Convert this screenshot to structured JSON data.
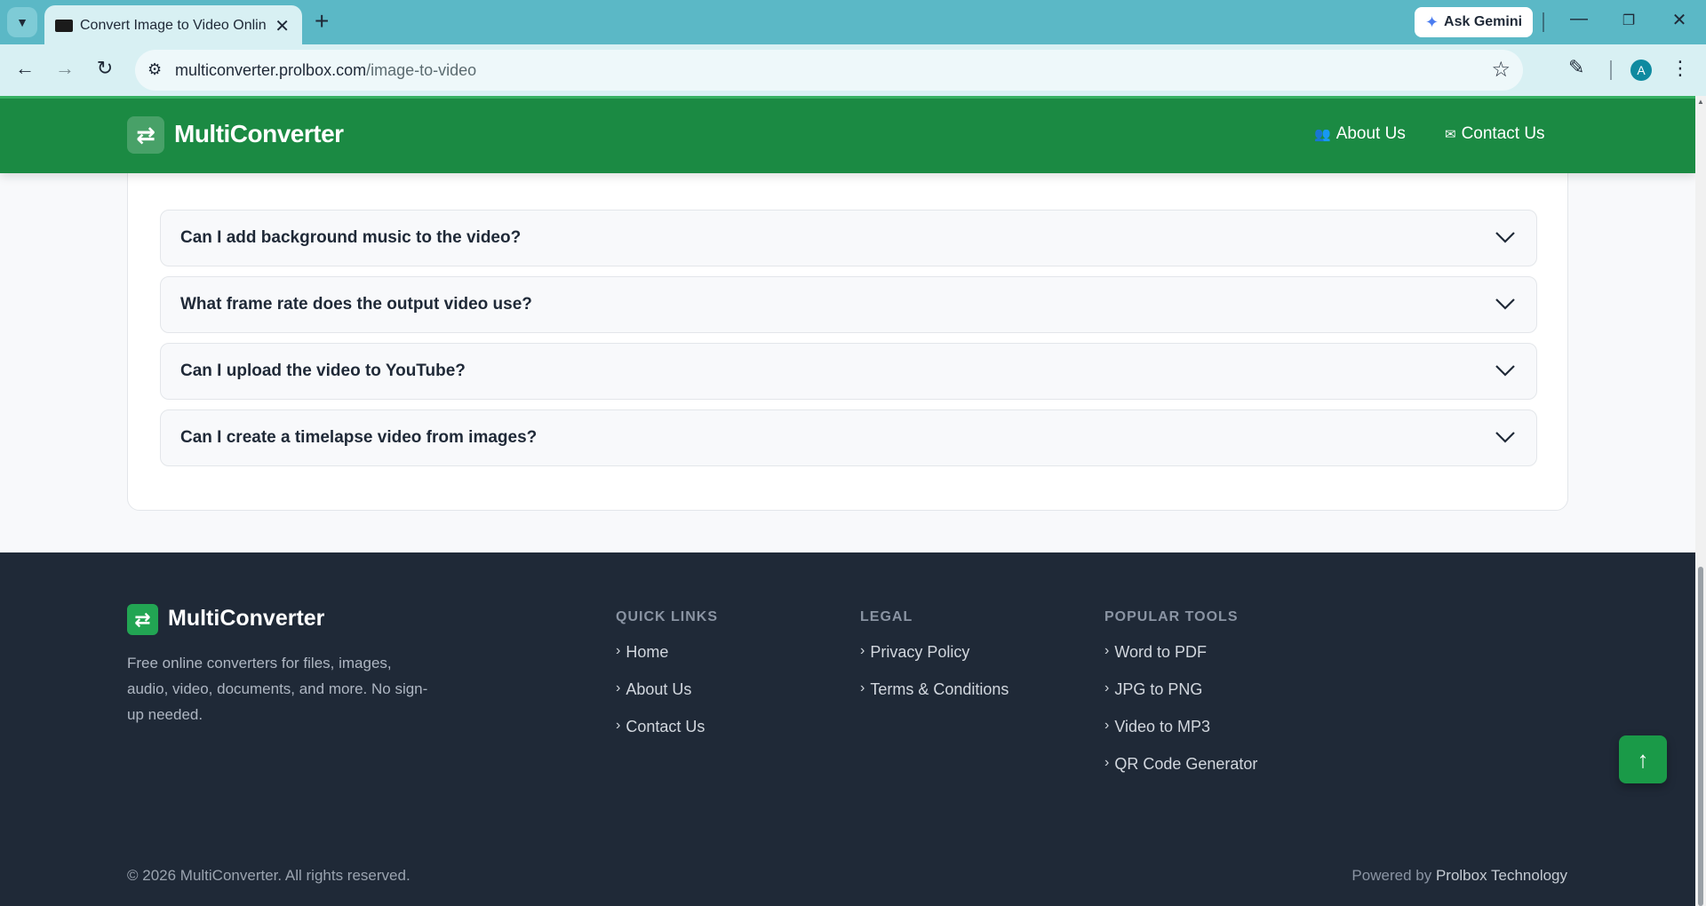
{
  "browser": {
    "tab_title": "Convert Image to Video Online",
    "url_domain": "multiconverter.prolbox.com",
    "url_path": "/image-to-video",
    "gemini_label": "Ask Gemini",
    "profile_initial": "A"
  },
  "header": {
    "logo_text": "MultiConverter",
    "nav": [
      {
        "label": "About Us",
        "icon": "users-icon"
      },
      {
        "label": "Contact Us",
        "icon": "envelope-icon"
      }
    ]
  },
  "faq": {
    "items": [
      {
        "question": "Can I add background music to the video?"
      },
      {
        "question": "What frame rate does the output video use?"
      },
      {
        "question": "Can I upload the video to YouTube?"
      },
      {
        "question": "Can I create a timelapse video from images?"
      }
    ]
  },
  "footer": {
    "logo_text": "MultiConverter",
    "description": "Free online converters for files, images, audio, video, documents, and more. No sign-up needed.",
    "columns": [
      {
        "heading": "QUICK LINKS",
        "links": [
          "Home",
          "About Us",
          "Contact Us"
        ]
      },
      {
        "heading": "LEGAL",
        "links": [
          "Privacy Policy",
          "Terms & Conditions"
        ]
      },
      {
        "heading": "POPULAR TOOLS",
        "links": [
          "Word to PDF",
          "JPG to PNG",
          "Video to MP3",
          "QR Code Generator"
        ]
      }
    ],
    "copyright": "© 2026 MultiConverter. All rights reserved.",
    "powered_prefix": "Powered by",
    "powered_brand": "Prolbox Technology"
  },
  "colors": {
    "header_green": "#1b8a43",
    "footer_bg": "#1f2937",
    "accent_green": "#22a553"
  }
}
